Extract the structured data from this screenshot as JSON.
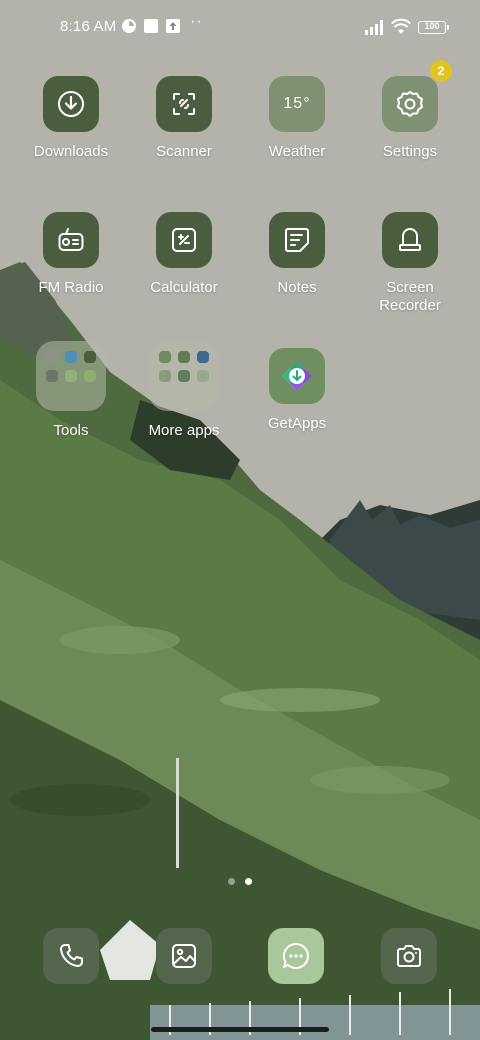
{
  "status_bar": {
    "time": "8:16 AM",
    "overflow": "··",
    "battery": "100",
    "icons": [
      "data-saver-icon",
      "square-notification-icon",
      "upload-arrow-icon",
      "signal-bars-icon",
      "wifi-icon",
      "battery-icon"
    ]
  },
  "apps": [
    {
      "label": "Downloads",
      "icon": "download-arrow-icon"
    },
    {
      "label": "Scanner",
      "icon": "scanner-icon"
    },
    {
      "label": "Weather",
      "icon": "weather-temp-icon",
      "temp": "15°"
    },
    {
      "label": "Settings",
      "icon": "gear-icon",
      "badge": "2"
    },
    {
      "label": "FM Radio",
      "icon": "radio-icon"
    },
    {
      "label": "Calculator",
      "icon": "calculator-icon"
    },
    {
      "label": "Notes",
      "icon": "notes-icon"
    },
    {
      "label": "Screen Recorder",
      "label_line1": "Screen",
      "label_line2": "Recorder",
      "icon": "screen-recorder-icon"
    },
    {
      "label": "Tools",
      "icon": "folder-icon"
    },
    {
      "label": "More apps",
      "icon": "folder-icon"
    },
    {
      "label": "GetApps",
      "icon": "getapps-icon"
    }
  ],
  "pager": {
    "pages": 2,
    "current": 2
  },
  "dock": [
    {
      "name": "phone",
      "icon": "phone-icon"
    },
    {
      "name": "gallery",
      "icon": "gallery-icon"
    },
    {
      "name": "messages",
      "icon": "message-bubble-icon"
    },
    {
      "name": "camera",
      "icon": "camera-icon"
    }
  ],
  "colors": {
    "sky": "#b3b2ab",
    "tile_dark": "#4b5d3f",
    "tile_light": "#7f9073",
    "badge": "#e2c41f",
    "messages_tile": "#a9c79a"
  }
}
